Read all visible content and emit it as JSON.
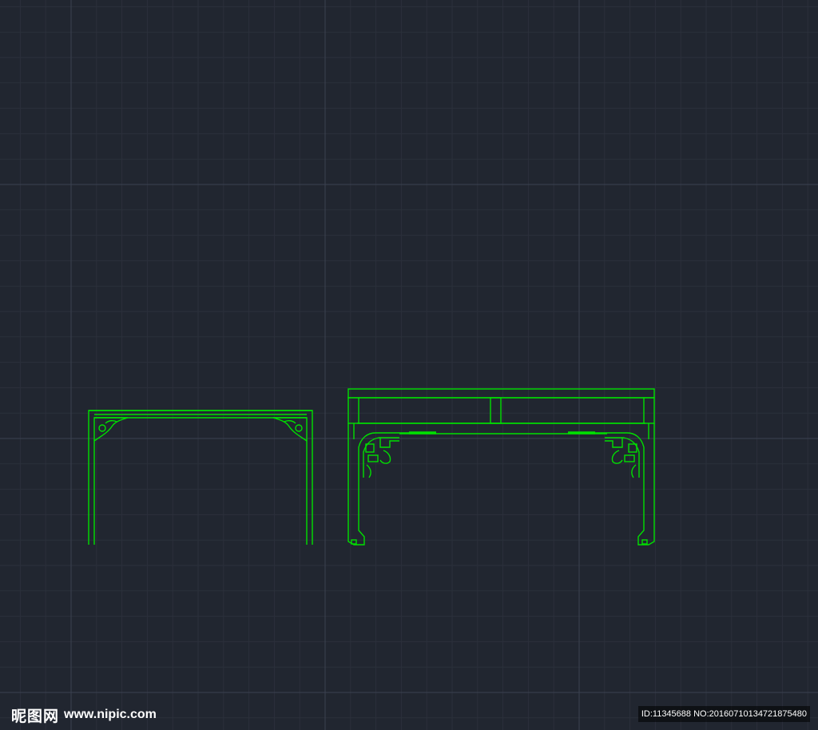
{
  "colors": {
    "background": "#212630",
    "grid_minor": "#2b303b",
    "grid_major": "#3b4150",
    "geometry": "#00e000"
  },
  "watermark": {
    "brand": "昵图网",
    "url": "www.nipic.com",
    "id_text": "ID:11345688 NO:20160710134721875480"
  }
}
